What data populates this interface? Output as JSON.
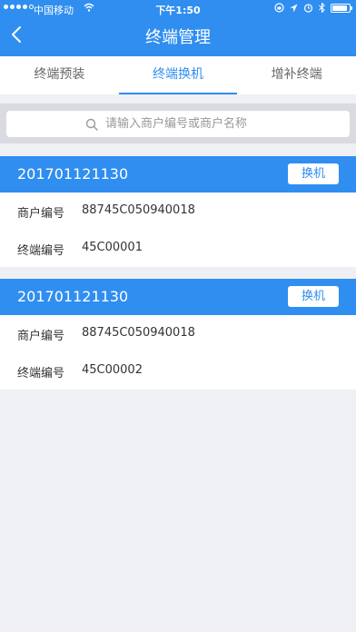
{
  "status_bar": {
    "carrier": "中国移动",
    "time": "下午1:50"
  },
  "header": {
    "title": "终端管理"
  },
  "tabs": [
    {
      "label": "终端预装",
      "active": false
    },
    {
      "label": "终端换机",
      "active": true
    },
    {
      "label": "增补终端",
      "active": false
    }
  ],
  "search": {
    "placeholder": "请输入商户编号或商户名称",
    "value": ""
  },
  "records": [
    {
      "id": "201701121130",
      "action_label": "换机",
      "merchant_label": "商户编号",
      "merchant_no": "88745C050940018",
      "terminal_label": "终端编号",
      "terminal_no": "45C00001"
    },
    {
      "id": "201701121130",
      "action_label": "换机",
      "merchant_label": "商户编号",
      "merchant_no": "88745C050940018",
      "terminal_label": "终端编号",
      "terminal_no": "45C00002"
    }
  ],
  "colors": {
    "primary": "#2f8ef0",
    "background": "#eef0f4",
    "search_bar": "#d9dbe0"
  },
  "icons": {
    "back": "chevron-left-icon",
    "search": "search-icon",
    "wifi": "wifi-icon",
    "location": "location-arrow-icon",
    "alarm": "alarm-icon",
    "bluetooth": "bluetooth-icon",
    "battery": "battery-icon"
  }
}
